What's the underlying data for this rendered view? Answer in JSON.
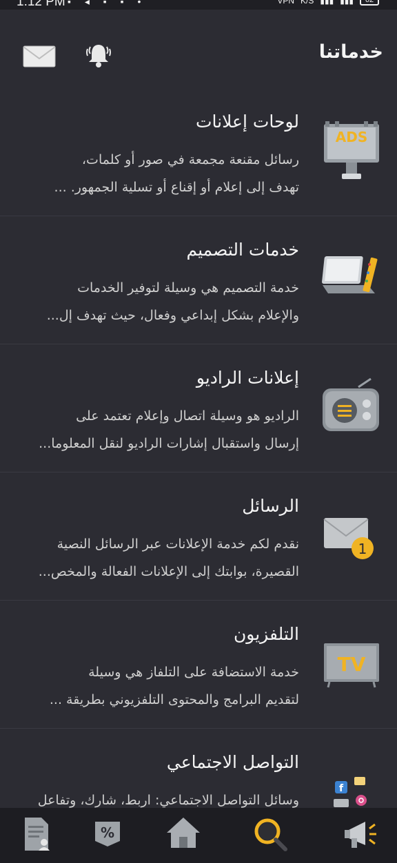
{
  "status_bar": {
    "time": "1:12 PM",
    "network_label": "K/S",
    "battery": "62"
  },
  "header": {
    "title": "خدماتنا",
    "mail_icon": "mail-icon",
    "bell_icon": "bell-icon"
  },
  "services": [
    {
      "title": "لوحات إعلانات",
      "desc_line1": "رسائل مقنعة مجمعة في صور أو كلمات،",
      "desc_line2": "تهدف إلى إعلام أو إقناع أو تسلية الجمهور. ...",
      "icon": "billboard-ads-icon",
      "icon_text": "ADS"
    },
    {
      "title": "خدمات التصميم",
      "desc_line1": "خدمة التصميم هي وسيلة لتوفير الخدمات",
      "desc_line2": "والإعلام بشكل إبداعي وفعال، حيث تهدف إل...",
      "icon": "laptop-design-icon"
    },
    {
      "title": "إعلانات الراديو",
      "desc_line1": "الراديو هو وسيلة اتصال وإعلام تعتمد على",
      "desc_line2": "إرسال واستقبال إشارات الراديو لنقل المعلوما...",
      "icon": "radio-icon"
    },
    {
      "title": "الرسائل",
      "desc_line1": "نقدم لكم خدمة الإعلانات عبر الرسائل النصية",
      "desc_line2": "القصيرة، بوابتك إلى الإعلانات الفعالة والمخص...",
      "icon": "envelope-notification-icon",
      "badge": "1"
    },
    {
      "title": "التلفزيون",
      "desc_line1": "خدمة الاستضافة على التلفاز هي وسيلة",
      "desc_line2": "لتقديم البرامج والمحتوى التلفزيوني بطريقة ...",
      "icon": "tv-icon",
      "icon_text": "TV"
    },
    {
      "title": "التواصل الاجتماعي",
      "desc_line1": "وسائل التواصل الاجتماعي: اربط، شارك، وتفاعل",
      "desc_line2": "",
      "icon": "social-media-icon"
    }
  ],
  "bottom_nav": [
    {
      "name": "profile-document-icon"
    },
    {
      "name": "discount-tag-icon",
      "label": "%"
    },
    {
      "name": "home-icon"
    },
    {
      "name": "search-icon"
    },
    {
      "name": "megaphone-icon"
    }
  ],
  "colors": {
    "background": "#2c2c33",
    "nav_background": "#1d1d22",
    "accent_yellow": "#f0b323",
    "text_primary": "#f4f4f4",
    "text_secondary": "#cfcfcf"
  }
}
